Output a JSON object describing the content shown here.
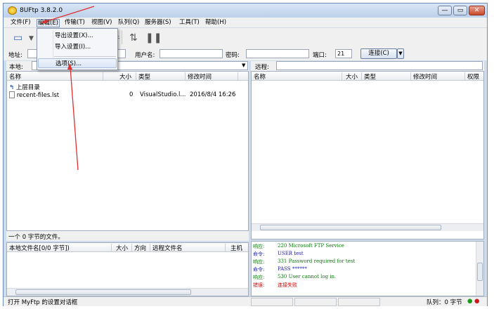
{
  "window": {
    "title": "8UFtp 3.8.2.0",
    "buttons": [
      "—",
      "▭",
      "✕"
    ]
  },
  "menubar": {
    "items": [
      "文件(F)",
      "编辑(E)",
      "传输(T)",
      "视图(V)",
      "队列(Q)",
      "服务器(S)",
      "工具(T)",
      "帮助(H)"
    ]
  },
  "edit_menu": {
    "items": [
      "导出设置(X)...",
      "导入设置(I)...",
      "选项(S)..."
    ]
  },
  "toolbar": {
    "partial_label": "斤"
  },
  "address_bar": {
    "address_label": "地址:",
    "user_label": "用户名:",
    "password_label": "密码:",
    "port_label": "端口:",
    "port_value": "21",
    "connect_label": "连接(C)"
  },
  "local": {
    "path_label": "本地:",
    "columns": [
      "名称",
      "大小",
      "类型",
      "修改时间"
    ],
    "rows": [
      {
        "name": "上层目录",
        "size": "",
        "type": "",
        "mtime": ""
      },
      {
        "name": "recent-files.lst",
        "size": "0",
        "type": "VisualStudio.l...",
        "mtime": "2016/8/4 16:26"
      }
    ],
    "status": "一个 0 字节的文件。"
  },
  "remote": {
    "path_label": "远程:",
    "columns": [
      "名称",
      "大小",
      "类型",
      "修改时间",
      "权限"
    ]
  },
  "queue": {
    "columns": [
      "本地文件名[0/0 字节])",
      "大小",
      "方向",
      "远程文件名",
      "主机"
    ]
  },
  "log": {
    "lines": [
      {
        "tag": "响应:",
        "text": "220 Microsoft FTP Service",
        "color": "#0a7a0a"
      },
      {
        "tag": "命令:",
        "text": "USER test",
        "color": "#1a1aa8"
      },
      {
        "tag": "响应:",
        "text": "331 Password required for test",
        "color": "#0a7a0a"
      },
      {
        "tag": "命令:",
        "text": "PASS ******",
        "color": "#1a1aa8"
      },
      {
        "tag": "响应:",
        "text": "530 User cannot log in.",
        "color": "#0a7a0a"
      },
      {
        "tag": "错误:",
        "text": "连接失败",
        "color": "#d40000"
      }
    ]
  },
  "statusbar": {
    "left": "打开 MyFtp 的设置对话框",
    "queue": "队列：0 字节"
  },
  "colors": {
    "annotation_arrow": "#e03030"
  }
}
